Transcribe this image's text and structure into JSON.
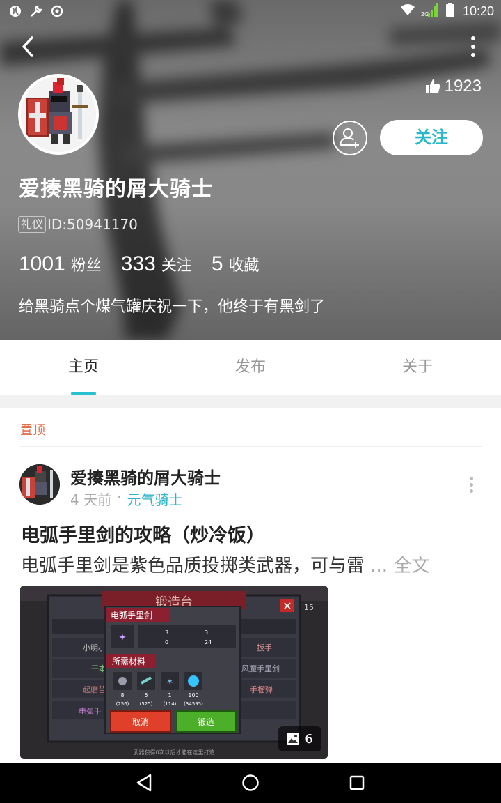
{
  "status_bar": {
    "time": "10:20",
    "network": "2G",
    "icons": [
      "browser-icon",
      "wrench-icon",
      "game-icon",
      "wifi-icon",
      "signal-icon",
      "battery-icon"
    ]
  },
  "header": {
    "likes": "1923",
    "follow_label": "关注",
    "username": "爱揍黑骑的屑大骑士",
    "badge": "礼仪",
    "user_id": "ID:50941170",
    "stats": [
      {
        "value": "1001",
        "label": "粉丝"
      },
      {
        "value": "333",
        "label": "关注"
      },
      {
        "value": "5",
        "label": "收藏"
      }
    ],
    "bio": "给黑骑点个煤气罐庆祝一下，他终于有黑剑了"
  },
  "tabs": [
    {
      "label": "主页",
      "active": true
    },
    {
      "label": "发布",
      "active": false
    },
    {
      "label": "关于",
      "active": false
    }
  ],
  "pinned": {
    "label": "置顶",
    "post": {
      "author": "爱揍黑骑的屑大骑士",
      "time": "4 天前",
      "separator": "·",
      "topic": "元气骑士",
      "title": "电弧手里剑的攻略（炒冷饭）",
      "excerpt": "电弧手里剑是紫色品质投掷类武器，可与雷",
      "more": " ... 全文",
      "image_count": "6",
      "image": {
        "panel_title": "锻造台",
        "weapon_name": "电弧手里剑",
        "stats": [
          "3",
          "3",
          "0",
          "24"
        ],
        "materials_title": "所需材料",
        "materials": [
          {
            "count": "8",
            "stock": "(256)"
          },
          {
            "count": "5",
            "stock": "(525)"
          },
          {
            "count": "1",
            "stock": "(114)"
          },
          {
            "count": "100",
            "stock": "(34595)"
          }
        ],
        "cancel_label": "取消",
        "forge_label": "锻造",
        "list_items": [
          "小明小",
          "干本",
          "起磨苦",
          "电弧手",
          "扳手",
          "风魔手里剑",
          "手榴弹"
        ],
        "footer": "武器获得0次以后才能在这里打造",
        "side_number": "15"
      }
    }
  },
  "colors": {
    "accent": "#29c0cf",
    "pin": "#e5704f",
    "forge": "#4caf2a",
    "cancel": "#e0402a"
  }
}
